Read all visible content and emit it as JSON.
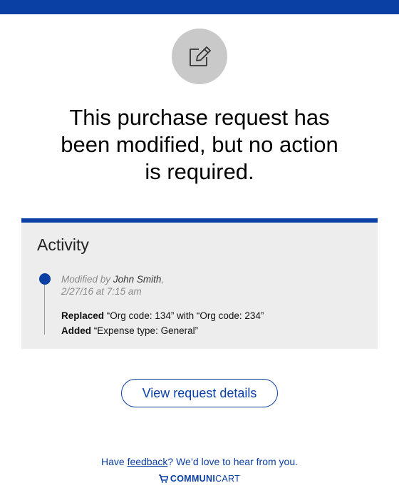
{
  "colors": {
    "brand_blue": "#0a3fa3",
    "icon_circle": "#c9c9c9",
    "panel_bg": "#ededed"
  },
  "header": {
    "icon": "edit-icon"
  },
  "headline": {
    "line1": "This purchase request has",
    "line2": "been modified, but no action",
    "line3": "is required."
  },
  "activity": {
    "title": "Activity",
    "entry": {
      "prefix": "Modified by",
      "author": "John Smith",
      "separator": ",",
      "timestamp": "2/27/16 at 7:15 am",
      "changes": [
        {
          "action": "Replaced",
          "detail": "“Org code: 134” with “Org code: 234”"
        },
        {
          "action": "Added",
          "detail": "“Expense type: General”"
        }
      ]
    }
  },
  "actions": {
    "view_details_label": "View request details"
  },
  "footer": {
    "feedback_prefix": "Have ",
    "feedback_link": "feedback",
    "feedback_suffix": "? We’d love to hear from you.",
    "brand_icon": "cart-icon",
    "brand_strong": "COMMUNI",
    "brand_light": "CART"
  }
}
